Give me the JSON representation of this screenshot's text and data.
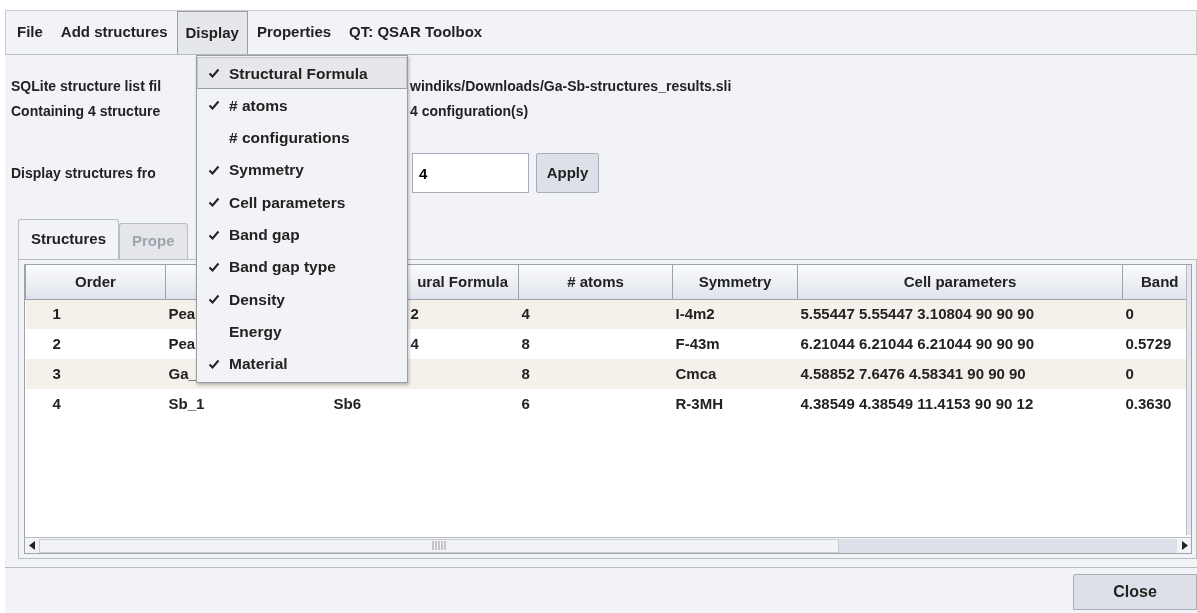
{
  "menubar": [
    {
      "label": "File",
      "selected": false
    },
    {
      "label": "Add structures",
      "selected": false
    },
    {
      "label": "Display",
      "selected": true
    },
    {
      "label": "Properties",
      "selected": false
    },
    {
      "label": "QT: QSAR Toolbox",
      "selected": false
    }
  ],
  "dropdown": {
    "items": [
      {
        "label": "Structural Formula",
        "checked": true,
        "selected": true
      },
      {
        "label": "# atoms",
        "checked": true,
        "selected": false
      },
      {
        "label": "# configurations",
        "checked": false,
        "selected": false
      },
      {
        "label": "Symmetry",
        "checked": true,
        "selected": false
      },
      {
        "label": "Cell parameters",
        "checked": true,
        "selected": false
      },
      {
        "label": "Band gap",
        "checked": true,
        "selected": false
      },
      {
        "label": "Band gap type",
        "checked": true,
        "selected": false
      },
      {
        "label": "Density",
        "checked": true,
        "selected": false
      },
      {
        "label": "Energy",
        "checked": false,
        "selected": false
      },
      {
        "label": "Material",
        "checked": true,
        "selected": false
      }
    ]
  },
  "info": {
    "file_label": "SQLite structure list fil",
    "file_path": "windiks/Downloads/Ga-Sb-structures_results.sli",
    "count_label": "Containing 4 structure",
    "count_tail": "4 configuration(s)"
  },
  "range": {
    "label": "Display structures fro",
    "value": "4",
    "button": "Apply"
  },
  "tabs": [
    {
      "label": "Structures",
      "selected": true
    },
    {
      "label": "Prope",
      "selected": false
    }
  ],
  "table": {
    "columns": [
      {
        "label": "Order"
      },
      {},
      {
        "label": "ural Formula",
        "obscured": true
      },
      {
        "label": "# atoms"
      },
      {
        "label": "Symmetry"
      },
      {
        "label": "Cell parameters"
      },
      {
        "label": "Band"
      }
    ],
    "rows": [
      [
        "1",
        "Pea",
        {
          "text": "2",
          "obscured": true
        },
        "4",
        "I-4m2",
        "5.55447 5.55447 3.10804 90 90 90",
        "0"
      ],
      [
        "2",
        "Pea",
        {
          "text": "4",
          "obscured": true
        },
        "8",
        "F-43m",
        "6.21044 6.21044 6.21044 90 90 90",
        "0.5729"
      ],
      [
        "3",
        "Ga_",
        null,
        "8",
        "Cmca",
        "4.58852 7.6476 4.58341 90 90 90",
        "0"
      ],
      [
        "4",
        "Sb_1",
        "Sb6",
        "6",
        "R-3MH",
        "4.38549 4.38549 11.4153 90 90 12",
        "0.3630"
      ]
    ]
  },
  "close_button": "Close"
}
